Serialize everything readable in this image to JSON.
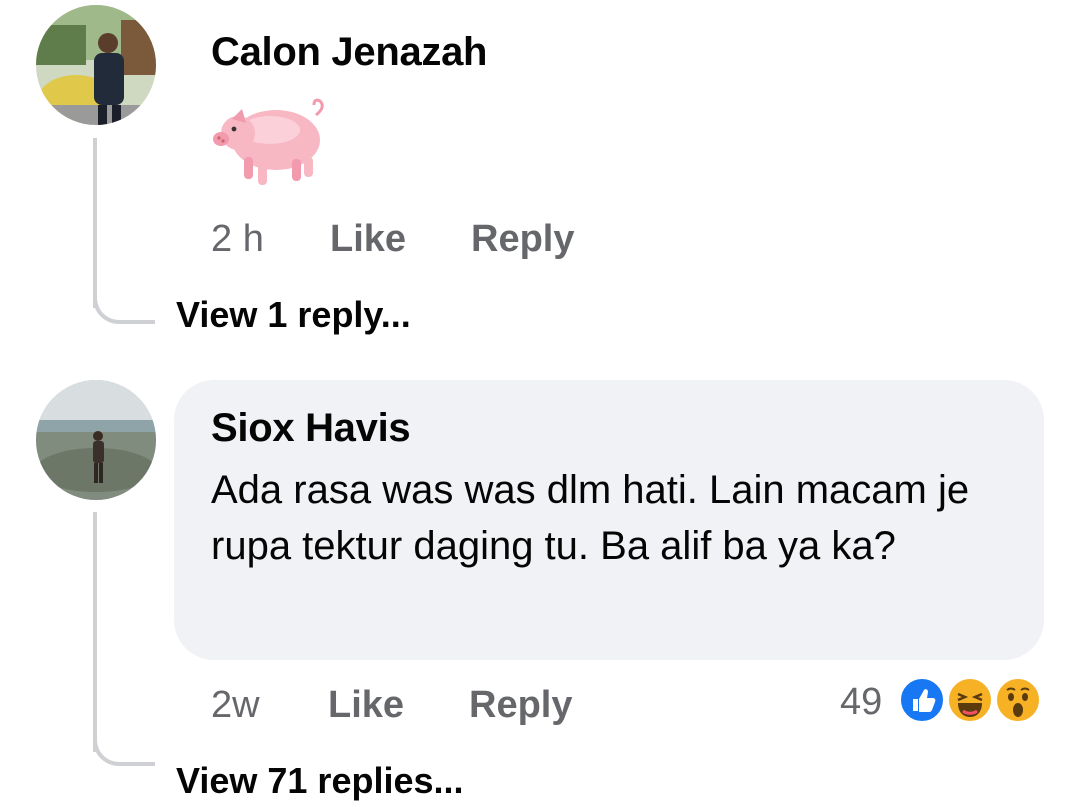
{
  "comments": [
    {
      "author": "Calon Jenazah",
      "sticker": "pig-emoji",
      "time": "2 h",
      "like_label": "Like",
      "reply_label": "Reply",
      "view_replies": "View 1 reply..."
    },
    {
      "author": "Siox Havis",
      "text": "Ada rasa was was dlm hati. Lain macam je rupa tektur daging tu. Ba alif ba ya ka?",
      "time": "2w",
      "like_label": "Like",
      "reply_label": "Reply",
      "reaction_count": "49",
      "reactions": [
        "like-icon",
        "haha-icon",
        "wow-icon"
      ],
      "view_replies": "View 71 replies..."
    }
  ],
  "colors": {
    "meta_gray": "#65676b",
    "bubble_bg": "#f0f2f5",
    "like_blue": "#1877f2",
    "emoji_yellow": "#f7b125"
  }
}
